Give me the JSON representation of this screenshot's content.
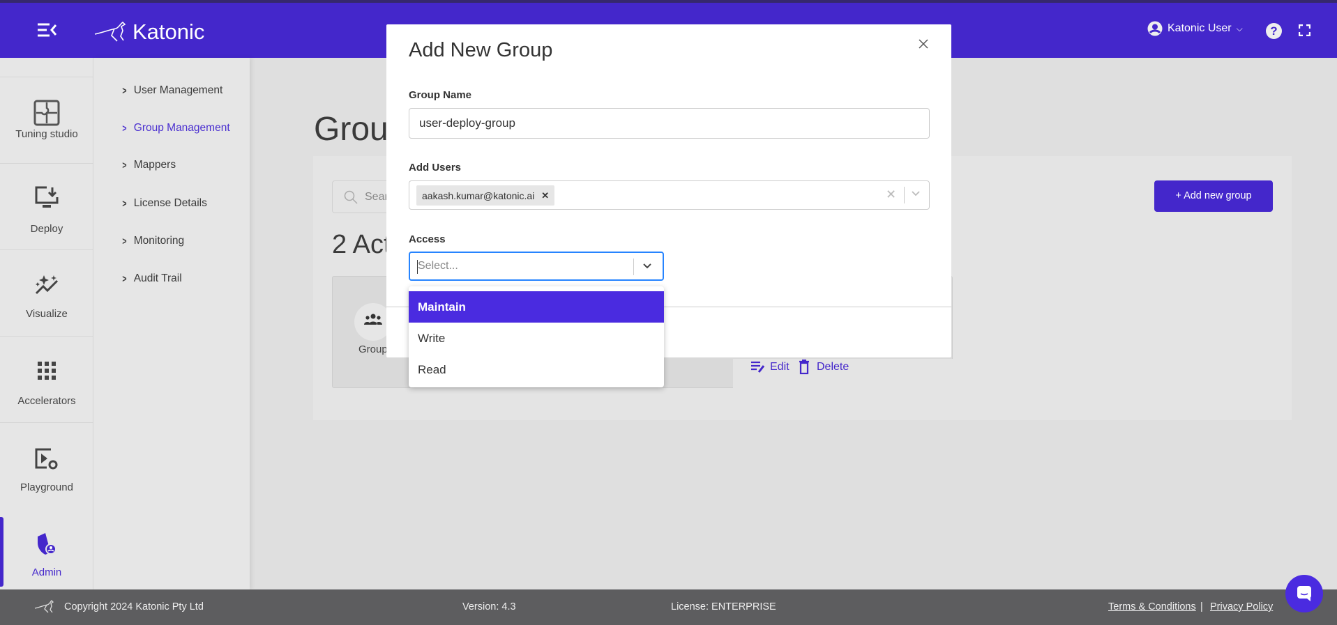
{
  "header": {
    "brand": "Katonic",
    "user_name": "Katonic User",
    "accent": "#4427cb"
  },
  "icon_sidebar": {
    "items": [
      {
        "label": "Tuning studio",
        "icon": "puzzle-icon"
      },
      {
        "label": "Deploy",
        "icon": "monitor-download-icon"
      },
      {
        "label": "Visualize",
        "icon": "sparkle-chart-icon"
      },
      {
        "label": "Accelerators",
        "icon": "grid-icon"
      },
      {
        "label": "Playground",
        "icon": "play-settings-icon"
      },
      {
        "label": "Admin",
        "icon": "shield-user-icon",
        "active": true
      }
    ]
  },
  "sub_nav": {
    "items": [
      {
        "label": "User Management"
      },
      {
        "label": "Group Management",
        "active": true
      },
      {
        "label": "Mappers"
      },
      {
        "label": "License Details"
      },
      {
        "label": "Monitoring"
      },
      {
        "label": "Audit Trail"
      }
    ]
  },
  "page": {
    "title": "Grou",
    "search_placeholder": "Sear",
    "count_text": "2 Act",
    "add_button": "+ Add new group",
    "card_label": "Group",
    "edit": "Edit",
    "delete": "Delete"
  },
  "modal": {
    "title": "Add New Group",
    "group_name_label": "Group Name",
    "group_name_value": "user-deploy-group",
    "add_users_label": "Add Users",
    "selected_users": [
      "aakash.kumar@katonic.ai"
    ],
    "access_label": "Access",
    "access_placeholder": "Select...",
    "access_options": [
      "Maintain",
      "Write",
      "Read"
    ],
    "highlighted_option": "Maintain"
  },
  "footer": {
    "copyright": "Copyright 2024 Katonic Pty Ltd",
    "version": "Version: 4.3",
    "license": "License: ENTERPRISE",
    "terms": "Terms & Conditions",
    "separator": "|",
    "privacy": "Privacy Policy"
  }
}
